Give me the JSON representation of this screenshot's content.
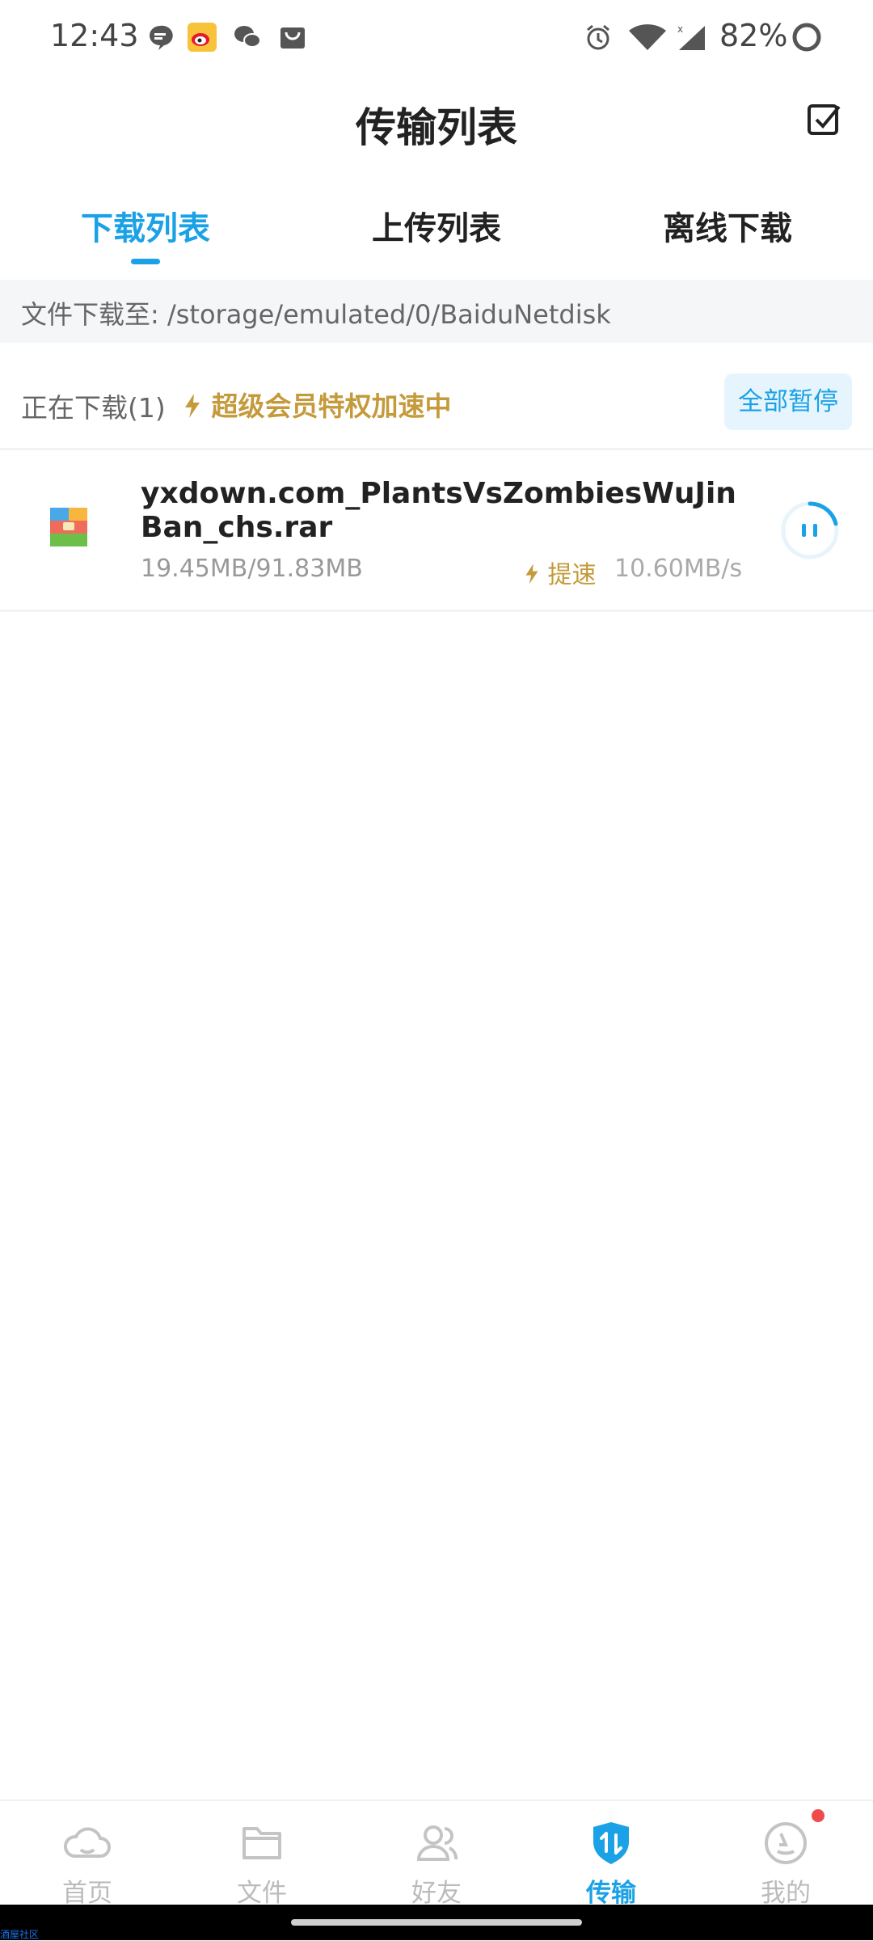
{
  "status_bar": {
    "time": "12:43",
    "battery": "82%"
  },
  "header": {
    "title": "传输列表"
  },
  "tabs": [
    {
      "label": "下载列表",
      "active": true
    },
    {
      "label": "上传列表",
      "active": false
    },
    {
      "label": "离线下载",
      "active": false
    }
  ],
  "path_bar": {
    "text": "文件下载至: /storage/emulated/0/BaiduNetdisk"
  },
  "section": {
    "count_label": "正在下载(1)",
    "vip_label": "超级会员特权加速中",
    "pause_all": "全部暂停"
  },
  "download_item": {
    "filename": "yxdown.com_PlantsVsZombiesWuJinBan_chs.rar",
    "size_progress": "19.45MB/91.83MB",
    "speedup_label": "提速",
    "speed": "10.60MB/s",
    "progress_fraction": 0.21
  },
  "bottom_nav": [
    {
      "label": "首页",
      "icon": "cloud-icon",
      "active": false
    },
    {
      "label": "文件",
      "icon": "folder-icon",
      "active": false
    },
    {
      "label": "好友",
      "icon": "friends-icon",
      "active": false
    },
    {
      "label": "传输",
      "icon": "transfer-icon",
      "active": true
    },
    {
      "label": "我的",
      "icon": "profile-icon",
      "active": false
    }
  ],
  "colors": {
    "accent": "#1aa1e6",
    "vip_gold": "#c49a3a",
    "badge_red": "#f04b4b"
  },
  "watermark": "酒屋社区"
}
